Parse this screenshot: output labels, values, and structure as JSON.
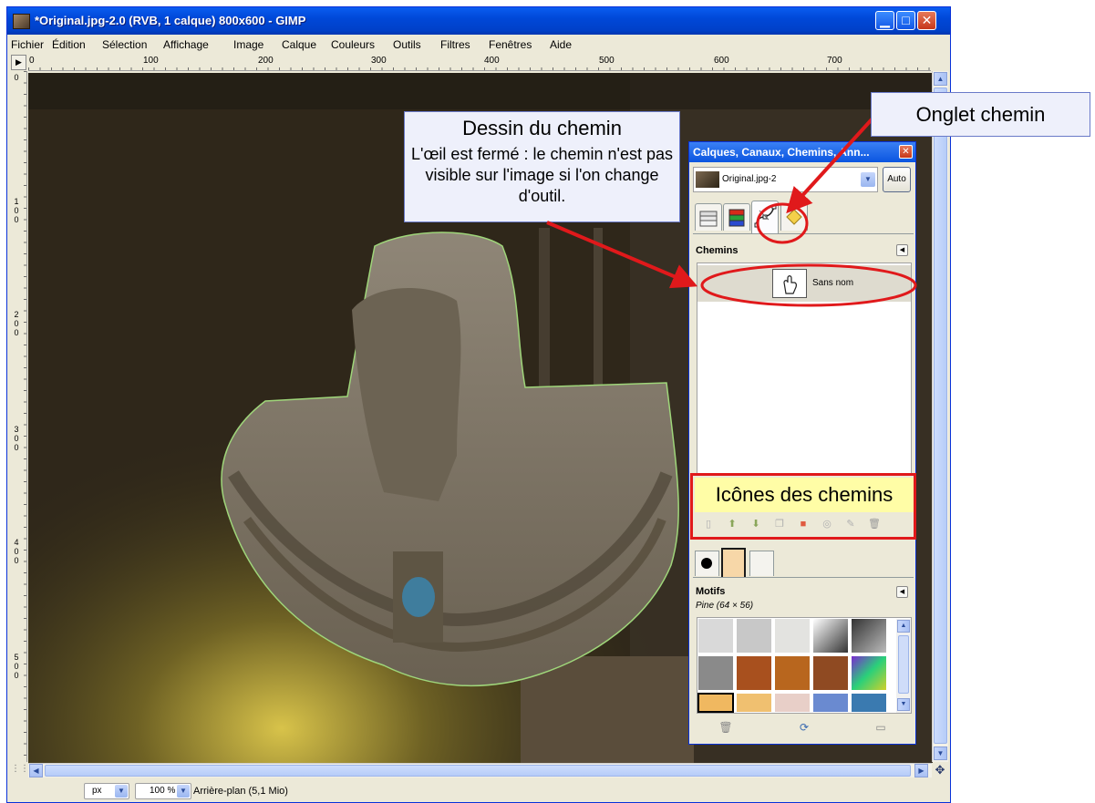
{
  "window": {
    "title": "*Original.jpg-2.0 (RVB, 1 calque) 800x600 - GIMP",
    "minimize_glyph": "▁",
    "maximize_glyph": "□",
    "close_glyph": "✕"
  },
  "menu": [
    "Fichier",
    "Édition",
    "Sélection",
    "Affichage",
    "Image",
    "Calque",
    "Couleurs",
    "Outils",
    "Filtres",
    "Fenêtres",
    "Aide"
  ],
  "ruler": {
    "corner_glyph": "▶",
    "h_ticks": [
      "0",
      "100",
      "200",
      "300",
      "400",
      "500",
      "600",
      "700"
    ],
    "v_ticks": [
      "0",
      "1\n0\n0",
      "2\n0\n0",
      "3\n0\n0",
      "4\n0\n0",
      "5\n0\n0"
    ]
  },
  "status": {
    "unit": "px",
    "zoom": "100 %",
    "text": "Arrière-plan (5,1 Mio)",
    "nav_glyph": "✥"
  },
  "dock": {
    "title": "Calques, Canaux, Chemins, Ann...",
    "close_glyph": "✕",
    "image_name": "Original.jpg-2",
    "auto_label": "Auto",
    "tabs": [
      "layers-tab-icon",
      "channels-tab-icon",
      "paths-tab-icon",
      "undo-tab-icon"
    ],
    "paths_header": "Chemins",
    "paths": [
      {
        "name": "Sans nom"
      }
    ],
    "motifs_header": "Motifs",
    "motif_selected": "Pine (64 × 56)"
  },
  "annotations": {
    "path_drawing_title": "Dessin du chemin",
    "path_drawing_text": "L'œil est fermé : le chemin n'est pas visible sur l'image si l'on change d'outil.",
    "tab_label": "Onglet chemin",
    "icons_label": "Icônes des chemins"
  },
  "colors": {
    "accent_red": "#e0191b",
    "titlebar_blue": "#0048D8",
    "path_green": "#9fd67a"
  }
}
